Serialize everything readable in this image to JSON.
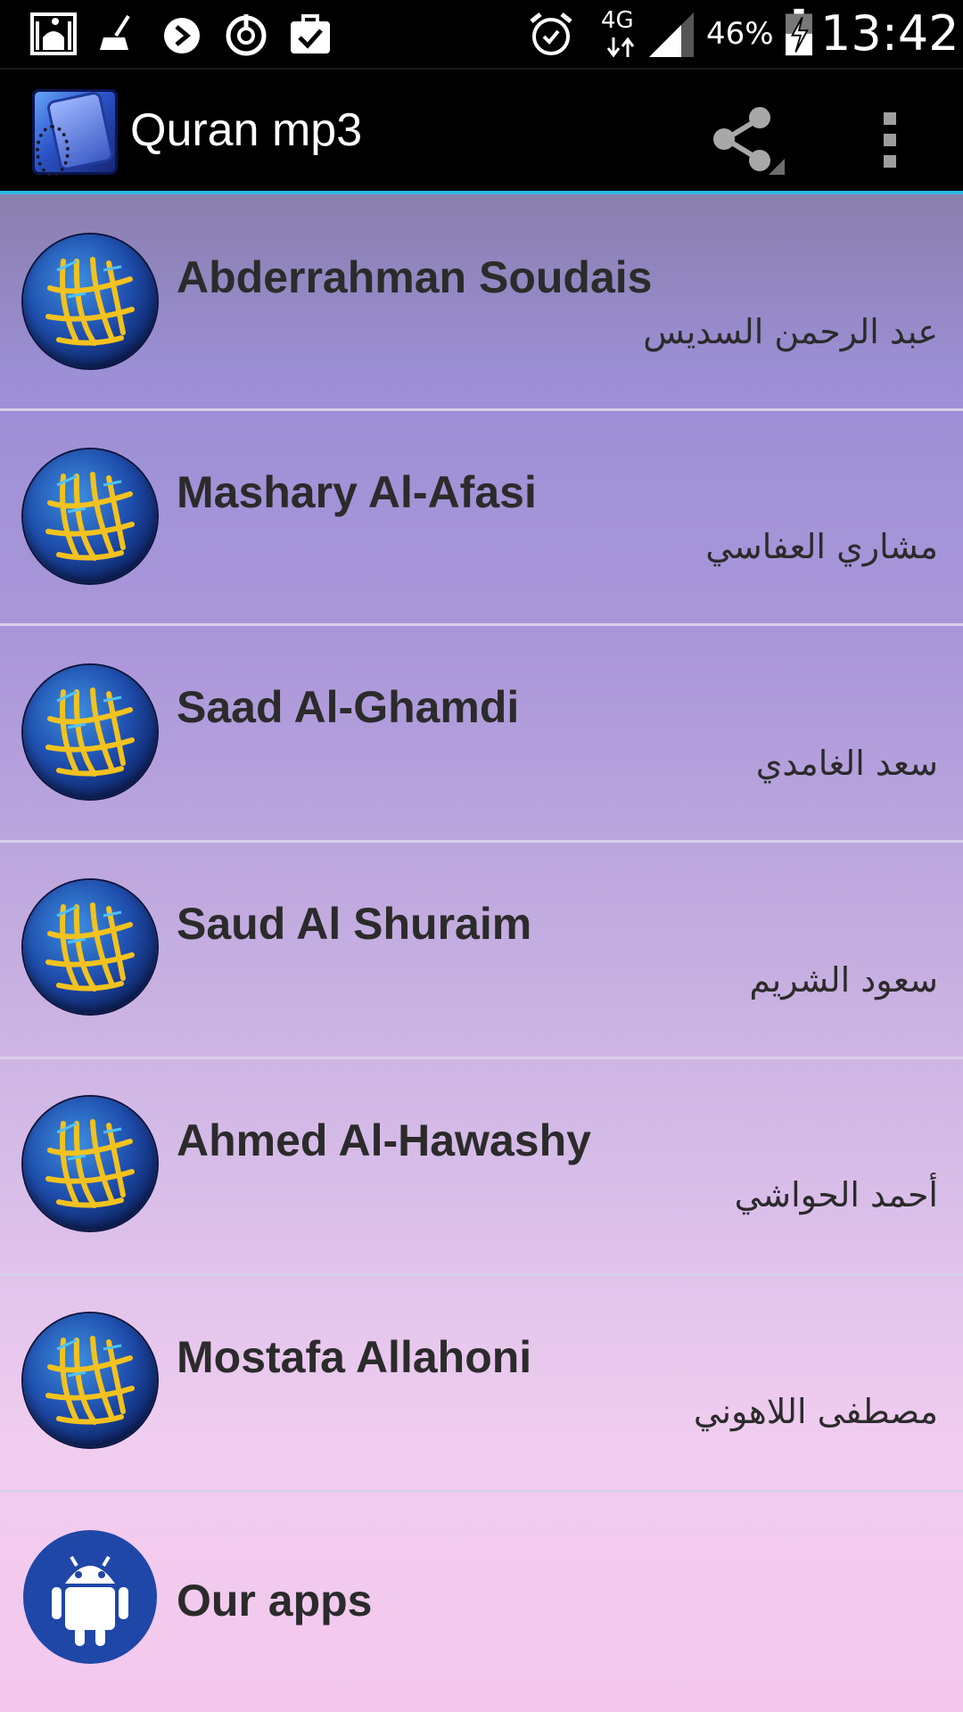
{
  "status_bar": {
    "left_icons": [
      "mosque-icon",
      "broom-icon",
      "sync-arrow-icon",
      "power-timer-icon",
      "clipboard-check-icon"
    ],
    "right_icons": [
      "alarm-icon",
      "network-4g-icon",
      "signal-icon",
      "battery-charging-icon"
    ],
    "network_label": "4G",
    "battery": "46%",
    "time": "13:42"
  },
  "action_bar": {
    "title": "Quran mp3",
    "share_icon": "share-icon",
    "overflow_icon": "overflow-menu-icon"
  },
  "reciters": [
    {
      "name": "Abderrahman Soudais",
      "arabic": "عبد الرحمن السديس"
    },
    {
      "name": "Mashary Al-Afasi",
      "arabic": "مشاري العفاسي"
    },
    {
      "name": "Saad Al-Ghamdi",
      "arabic": "سعد الغامدي"
    },
    {
      "name": "Saud Al Shuraim",
      "arabic": "سعود الشريم"
    },
    {
      "name": "Ahmed Al-Hawashy",
      "arabic": "أحمد الحواشي"
    },
    {
      "name": "Mostafa Allahoni",
      "arabic": "مصطفى اللاهوني"
    }
  ],
  "our_apps": {
    "label": "Our apps",
    "icon": "android-icon"
  },
  "colors": {
    "accent": "#33b5e5",
    "avatar_blue": "#1f4fae",
    "calligraphy_gold": "#f2c21e"
  }
}
